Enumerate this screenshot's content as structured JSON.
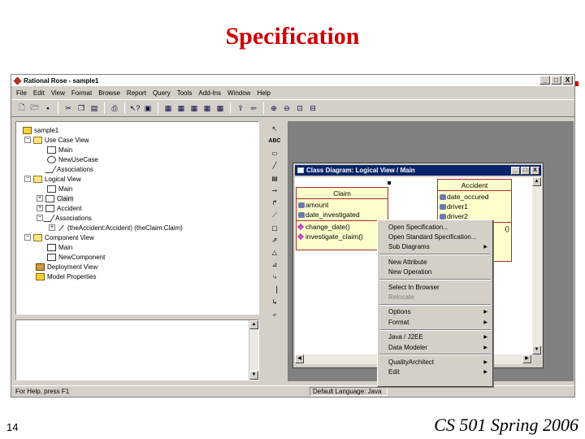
{
  "slide": {
    "title": "Specification",
    "number": "14",
    "footer": "CS 501 Spring 2006"
  },
  "app": {
    "title": "Rational Rose - sample1",
    "window_buttons": [
      "_",
      "□",
      "X"
    ],
    "menu": [
      "File",
      "Edit",
      "View",
      "Format",
      "Browse",
      "Report",
      "Query",
      "Tools",
      "Add-Ins",
      "Window",
      "Help"
    ],
    "toolbar_icons": [
      "new-icon",
      "open-icon",
      "save-icon",
      "cut-icon",
      "copy-icon",
      "paste-icon",
      "print-icon",
      "help-context-icon",
      "help-icon",
      "browse-class-icon",
      "browse-usecase-icon",
      "browse-component-icon",
      "browse-deployment-icon",
      "browse-parent-icon",
      "browse-previous-icon",
      "zoom-in-icon",
      "zoom-out-icon",
      "fit-window-icon",
      "undo-fit-icon"
    ]
  },
  "tree": {
    "items": [
      {
        "label": "sample1",
        "icon": "model-icon",
        "expander": ""
      },
      {
        "label": "Use Case View",
        "icon": "folder-icon",
        "expander": "−"
      },
      {
        "label": "Main",
        "icon": "diagram-icon",
        "expander": ""
      },
      {
        "label": "NewUseCase",
        "icon": "usecase-icon",
        "expander": ""
      },
      {
        "label": "Associations",
        "icon": "association-icon",
        "expander": ""
      },
      {
        "label": "Logical View",
        "icon": "folder-icon",
        "expander": "−"
      },
      {
        "label": "Main",
        "icon": "diagram-icon",
        "expander": ""
      },
      {
        "label": "Claim",
        "icon": "class-icon",
        "expander": "+"
      },
      {
        "label": "Accident",
        "icon": "class-icon",
        "expander": "+"
      },
      {
        "label": "Associations",
        "icon": "association-icon",
        "expander": "−"
      },
      {
        "label": "(theAccident:Accident) (theClaim:Claim)",
        "icon": "line-icon",
        "expander": "+"
      },
      {
        "label": "Component View",
        "icon": "folder-icon",
        "expander": "−"
      },
      {
        "label": "Main",
        "icon": "diagram-icon",
        "expander": ""
      },
      {
        "label": "NewComponent",
        "icon": "component-icon",
        "expander": ""
      },
      {
        "label": "Deployment View",
        "icon": "package-icon",
        "expander": ""
      },
      {
        "label": "Model Properties",
        "icon": "model-props-icon",
        "expander": ""
      }
    ]
  },
  "toolbox_icons": [
    "select-icon",
    "text-icon",
    "note-icon",
    "anchor-icon",
    "class-tool-icon",
    "interface-icon",
    "association-tool-icon",
    "aggregation-icon",
    "package-tool-icon",
    "dependency-icon",
    "generalization-icon",
    "realize-icon",
    "tool-a-icon",
    "tool-b-icon",
    "tool-c-icon",
    "tool-d-icon"
  ],
  "diagram": {
    "title": "Class Diagram: Logical View / Main",
    "window_buttons": [
      "_",
      "□",
      "X"
    ],
    "classes": [
      {
        "name": "Claim",
        "attributes": [
          "amount",
          "date_investigated"
        ],
        "operations": [
          "change_date()",
          "investigate_claim()"
        ]
      },
      {
        "name": "Accident",
        "attributes": [
          "date_occured",
          "driver1",
          "driver2"
        ],
        "operations": [
          "()"
        ]
      }
    ]
  },
  "context_menu": {
    "groups": [
      [
        {
          "label": "Open Specification...",
          "submenu": false,
          "disabled": false
        },
        {
          "label": "Open Standard Specification...",
          "submenu": false,
          "disabled": false
        },
        {
          "label": "Sub Diagrams",
          "submenu": true,
          "disabled": false
        }
      ],
      [
        {
          "label": "New Attribute",
          "submenu": false,
          "disabled": false
        },
        {
          "label": "New Operation",
          "submenu": false,
          "disabled": false
        }
      ],
      [
        {
          "label": "Select In Browser",
          "submenu": false,
          "disabled": false
        },
        {
          "label": "Relocate",
          "submenu": false,
          "disabled": true
        }
      ],
      [
        {
          "label": "Options",
          "submenu": true,
          "disabled": false
        },
        {
          "label": "Format",
          "submenu": true,
          "disabled": false
        }
      ],
      [
        {
          "label": "Java / J2EE",
          "submenu": true,
          "disabled": false
        },
        {
          "label": "Data Modeler",
          "submenu": true,
          "disabled": false
        }
      ],
      [
        {
          "label": "QualityArchitect",
          "submenu": true,
          "disabled": false
        },
        {
          "label": "Edit",
          "submenu": true,
          "disabled": false
        }
      ]
    ]
  },
  "status": {
    "left": "For Help, press F1",
    "right": "Default Language: Java"
  },
  "colors": {
    "title_red": "#cc0000",
    "active_caption": "#0a246a",
    "class_fill": "#ffffcc",
    "class_border": "#a03030",
    "face": "#d4d0c8"
  }
}
